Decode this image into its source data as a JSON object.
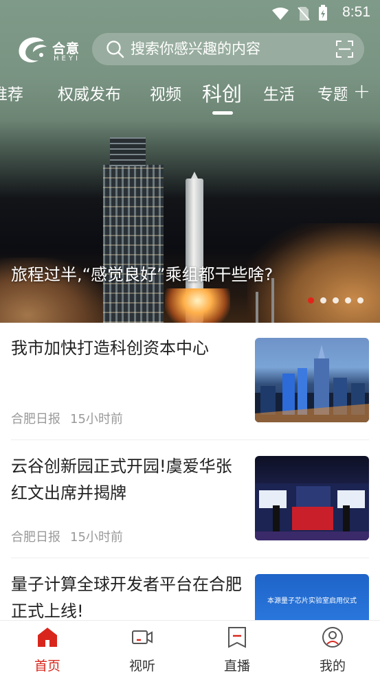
{
  "status_bar": {
    "time": "8:51",
    "icons": [
      "wifi-icon",
      "no-sim-icon",
      "battery-charging-icon"
    ]
  },
  "header": {
    "logo_cn": "合意",
    "logo_en": "HEYI",
    "search_placeholder": "搜索你感兴趣的内容"
  },
  "tabs": [
    {
      "label": "推荐"
    },
    {
      "label": "权威发布"
    },
    {
      "label": "视频"
    },
    {
      "label": "科创",
      "active": true
    },
    {
      "label": "生活"
    },
    {
      "label": "专题"
    }
  ],
  "banner": {
    "caption": "旅程过半,“感觉良好”乘组都干些啥?",
    "slide_count": 5,
    "active_slide": 1
  },
  "news": [
    {
      "title": "我市加快打造科创资本中心",
      "source": "合肥日报",
      "time": "15小时前"
    },
    {
      "title": "云谷创新园正式开园!虞爱华张红文出席并揭牌",
      "source": "合肥日报",
      "time": "15小时前"
    },
    {
      "title": "量子计算全球开发者平台在合肥正式上线!",
      "thumb_text": "本源量子芯片实验室启用仪式"
    }
  ],
  "bottom_nav": [
    {
      "label": "首页",
      "icon": "home-icon",
      "active": true
    },
    {
      "label": "视听",
      "icon": "video-icon"
    },
    {
      "label": "直播",
      "icon": "live-icon"
    },
    {
      "label": "我的",
      "icon": "profile-icon"
    }
  ],
  "colors": {
    "accent": "#d9261c",
    "header_green": "#7f9a88"
  }
}
